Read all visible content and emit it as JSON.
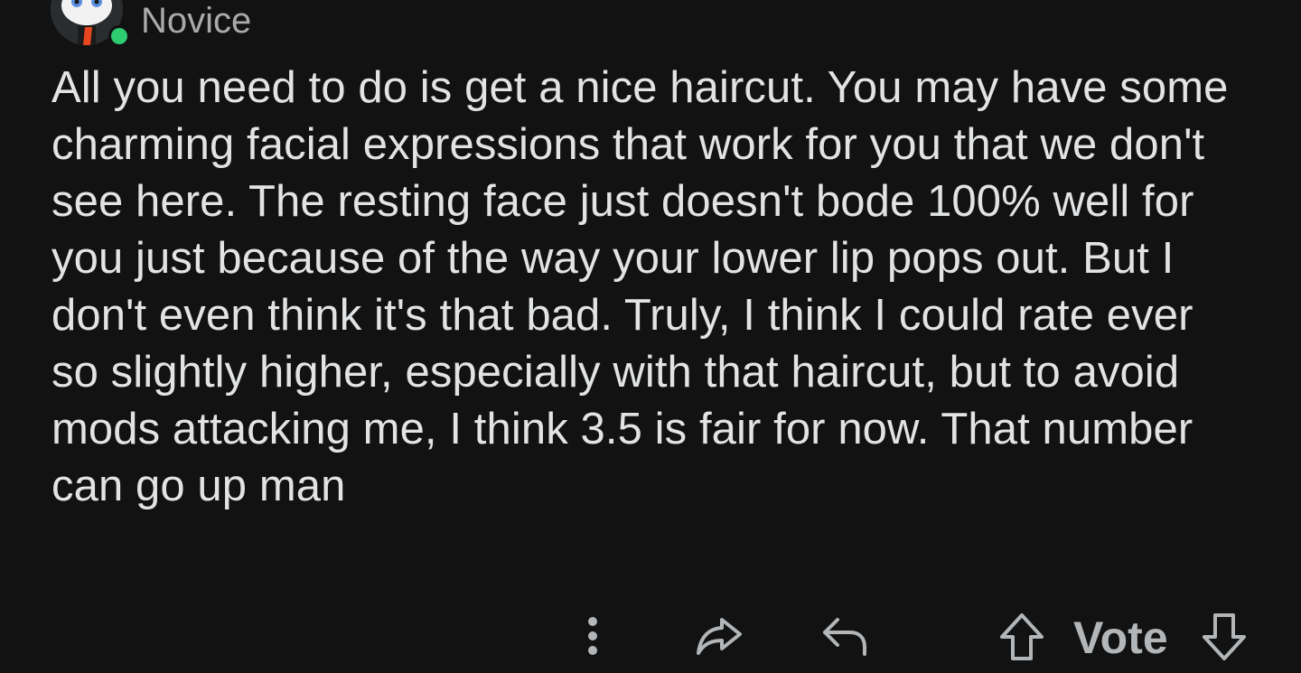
{
  "user": {
    "flair": "Novice",
    "avatar_icon": "snoo-avatar-icon",
    "online_status_color": "#2ecc71"
  },
  "comment": {
    "body": "All you need to do is get a nice haircut. You may have some charming facial expressions that work for you that we don't see here. The resting face just doesn't bode 100% well for you just because of the way your lower lip pops out. But I don't even think it's that bad. Truly, I think I could rate ever so slightly higher, especially with that haircut, but to avoid mods attacking me, I think 3.5 is fair for now. That number can go up man"
  },
  "actions": {
    "more_icon": "more-vertical-icon",
    "share_icon": "share-icon",
    "reply_icon": "reply-icon",
    "upvote_icon": "upvote-arrow-icon",
    "vote_label": "Vote",
    "downvote_icon": "downvote-arrow-icon"
  },
  "colors": {
    "background": "#121212",
    "text": "#e1e3e5",
    "muted_text": "#a8aaab",
    "icon": "#b3b6b8"
  }
}
